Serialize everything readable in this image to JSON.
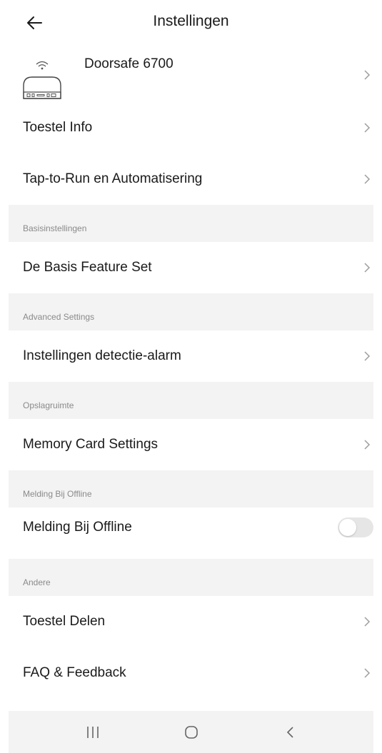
{
  "header": {
    "title": "Instellingen",
    "back_icon": "arrow-left-icon"
  },
  "device": {
    "name": "Doorsafe 6700",
    "icon": "router-device-icon"
  },
  "rows": {
    "device_info": "Toestel Info",
    "tap_to_run": "Tap-to-Run en Automatisering",
    "basic_feature_set": "De Basis Feature Set",
    "detection_alarm": "Instellingen detectie-alarm",
    "memory_card": "Memory Card Settings",
    "offline_notification": "Melding Bij Offline",
    "share_device": "Toestel Delen",
    "faq_feedback": "FAQ & Feedback"
  },
  "sections": {
    "basic": "Basisinstellingen",
    "advanced": "Advanced Settings",
    "storage": "Opslagruimte",
    "offline": "Melding Bij Offline",
    "other": "Andere"
  },
  "toggles": {
    "offline_notification_enabled": false
  },
  "colors": {
    "section_bg": "#f3f3f3",
    "section_text": "#8a8a8a",
    "chevron": "#9e9e9e",
    "toggle_off": "#e6e6e6"
  }
}
